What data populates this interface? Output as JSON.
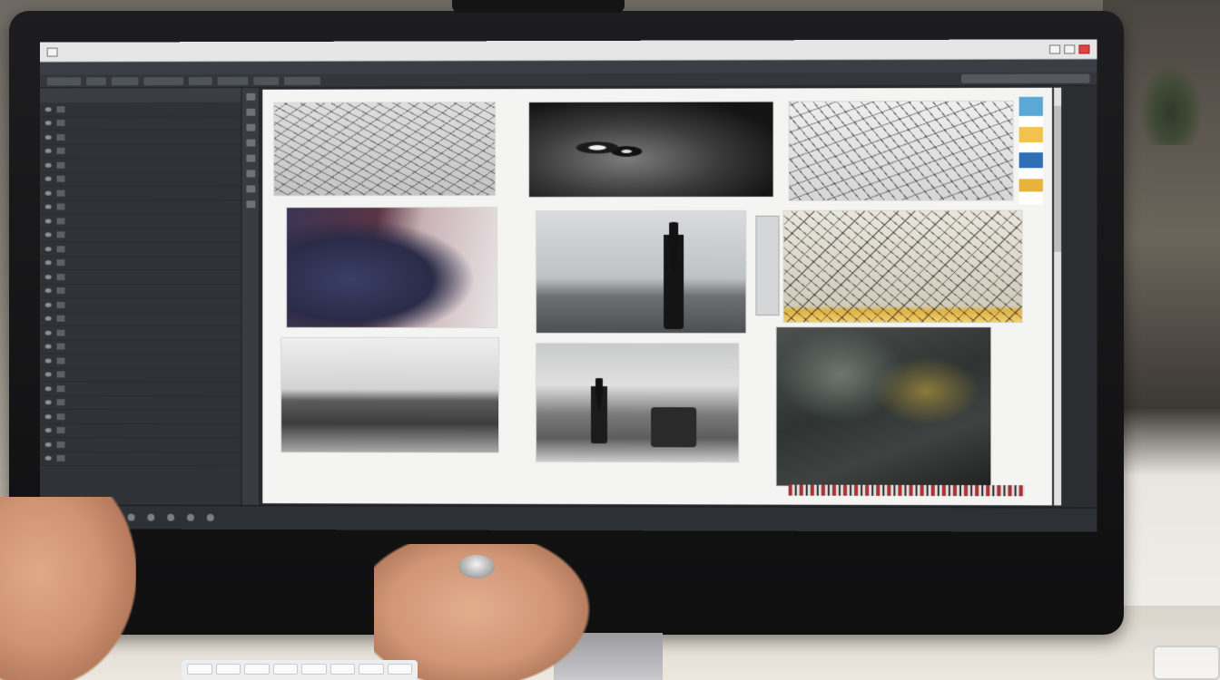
{
  "window": {
    "title": "",
    "menu": [
      "",
      "",
      "",
      "",
      "",
      "",
      "",
      "",
      "",
      ""
    ]
  },
  "layers_panel": {
    "header": "",
    "rows": [
      "",
      "",
      "",
      "",
      "",
      "",
      "",
      "",
      "",
      "",
      "",
      "",
      "",
      "",
      "",
      "",
      "",
      "",
      "",
      "",
      "",
      "",
      "",
      "",
      "",
      ""
    ]
  },
  "canvas": {
    "photos": [
      {
        "name": "branches-photo-1"
      },
      {
        "name": "face-closeup-photo"
      },
      {
        "name": "branches-photo-2"
      },
      {
        "name": "jacket-closeup-photo"
      },
      {
        "name": "silhouette-figure-photo"
      },
      {
        "name": "branches-photo-3"
      },
      {
        "name": "rock-landscape-photo"
      },
      {
        "name": "woman-on-shore-photo"
      },
      {
        "name": "dark-texture-photo"
      }
    ]
  },
  "status": {
    "items": [
      "",
      "",
      "",
      "",
      "",
      "",
      "",
      "",
      ""
    ]
  },
  "colors": {
    "ui_dark": "#2b2d31",
    "canvas": "#f4f4f2",
    "accent_red": "#c0392b"
  }
}
